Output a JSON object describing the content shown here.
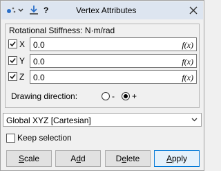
{
  "window": {
    "title": "Vertex Attributes",
    "help_label": "?",
    "icons": [
      "snap-settings-icon",
      "dropdown-arrow-icon",
      "download-icon",
      "close-icon"
    ]
  },
  "stiffness": {
    "group_title": "Rotational Stiffness: N·m/rad",
    "rows": [
      {
        "axis": "X",
        "checked": true,
        "value": "0.0",
        "fx": "f(x)"
      },
      {
        "axis": "Y",
        "checked": true,
        "value": "0.0",
        "fx": "f(x)"
      },
      {
        "axis": "Z",
        "checked": true,
        "value": "0.0",
        "fx": "f(x)"
      }
    ],
    "direction_label": "Drawing direction:",
    "direction_options": [
      {
        "label": "-",
        "selected": false
      },
      {
        "label": "+",
        "selected": true
      }
    ]
  },
  "coordinate_system": {
    "selected": "Global XYZ [Cartesian]"
  },
  "keep_selection": {
    "label": "Keep selection",
    "checked": false
  },
  "buttons": {
    "scale": {
      "first": "S",
      "rest": "cale"
    },
    "add": {
      "first": "A",
      "mid": "d",
      "rest": "d"
    },
    "delete": {
      "first": "D",
      "mid": "e",
      "rest": "lete"
    },
    "apply": {
      "first": "A",
      "rest": "pply"
    }
  },
  "colors": {
    "titlebar": "#dde5f0",
    "accent": "#0078d7",
    "check": "#1a1a1a"
  }
}
